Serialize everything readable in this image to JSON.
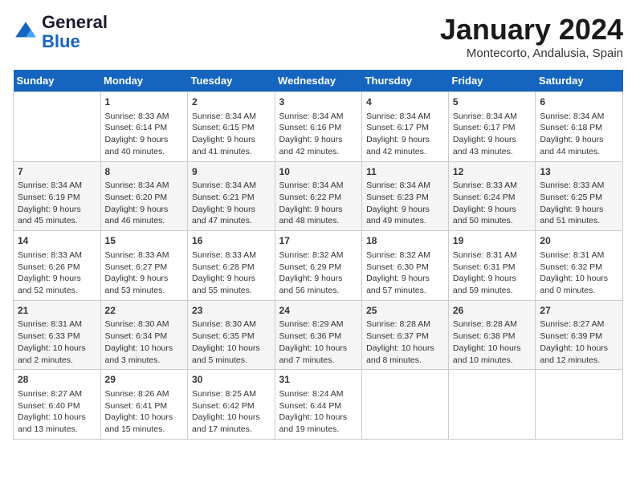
{
  "logo": {
    "line1": "General",
    "line2": "Blue"
  },
  "header": {
    "month": "January 2024",
    "location": "Montecorto, Andalusia, Spain"
  },
  "weekdays": [
    "Sunday",
    "Monday",
    "Tuesday",
    "Wednesday",
    "Thursday",
    "Friday",
    "Saturday"
  ],
  "weeks": [
    [
      {
        "day": "",
        "sunrise": "",
        "sunset": "",
        "daylight": ""
      },
      {
        "day": "1",
        "sunrise": "Sunrise: 8:33 AM",
        "sunset": "Sunset: 6:14 PM",
        "daylight": "Daylight: 9 hours and 40 minutes."
      },
      {
        "day": "2",
        "sunrise": "Sunrise: 8:34 AM",
        "sunset": "Sunset: 6:15 PM",
        "daylight": "Daylight: 9 hours and 41 minutes."
      },
      {
        "day": "3",
        "sunrise": "Sunrise: 8:34 AM",
        "sunset": "Sunset: 6:16 PM",
        "daylight": "Daylight: 9 hours and 42 minutes."
      },
      {
        "day": "4",
        "sunrise": "Sunrise: 8:34 AM",
        "sunset": "Sunset: 6:17 PM",
        "daylight": "Daylight: 9 hours and 42 minutes."
      },
      {
        "day": "5",
        "sunrise": "Sunrise: 8:34 AM",
        "sunset": "Sunset: 6:17 PM",
        "daylight": "Daylight: 9 hours and 43 minutes."
      },
      {
        "day": "6",
        "sunrise": "Sunrise: 8:34 AM",
        "sunset": "Sunset: 6:18 PM",
        "daylight": "Daylight: 9 hours and 44 minutes."
      }
    ],
    [
      {
        "day": "7",
        "sunrise": "Sunrise: 8:34 AM",
        "sunset": "Sunset: 6:19 PM",
        "daylight": "Daylight: 9 hours and 45 minutes."
      },
      {
        "day": "8",
        "sunrise": "Sunrise: 8:34 AM",
        "sunset": "Sunset: 6:20 PM",
        "daylight": "Daylight: 9 hours and 46 minutes."
      },
      {
        "day": "9",
        "sunrise": "Sunrise: 8:34 AM",
        "sunset": "Sunset: 6:21 PM",
        "daylight": "Daylight: 9 hours and 47 minutes."
      },
      {
        "day": "10",
        "sunrise": "Sunrise: 8:34 AM",
        "sunset": "Sunset: 6:22 PM",
        "daylight": "Daylight: 9 hours and 48 minutes."
      },
      {
        "day": "11",
        "sunrise": "Sunrise: 8:34 AM",
        "sunset": "Sunset: 6:23 PM",
        "daylight": "Daylight: 9 hours and 49 minutes."
      },
      {
        "day": "12",
        "sunrise": "Sunrise: 8:33 AM",
        "sunset": "Sunset: 6:24 PM",
        "daylight": "Daylight: 9 hours and 50 minutes."
      },
      {
        "day": "13",
        "sunrise": "Sunrise: 8:33 AM",
        "sunset": "Sunset: 6:25 PM",
        "daylight": "Daylight: 9 hours and 51 minutes."
      }
    ],
    [
      {
        "day": "14",
        "sunrise": "Sunrise: 8:33 AM",
        "sunset": "Sunset: 6:26 PM",
        "daylight": "Daylight: 9 hours and 52 minutes."
      },
      {
        "day": "15",
        "sunrise": "Sunrise: 8:33 AM",
        "sunset": "Sunset: 6:27 PM",
        "daylight": "Daylight: 9 hours and 53 minutes."
      },
      {
        "day": "16",
        "sunrise": "Sunrise: 8:33 AM",
        "sunset": "Sunset: 6:28 PM",
        "daylight": "Daylight: 9 hours and 55 minutes."
      },
      {
        "day": "17",
        "sunrise": "Sunrise: 8:32 AM",
        "sunset": "Sunset: 6:29 PM",
        "daylight": "Daylight: 9 hours and 56 minutes."
      },
      {
        "day": "18",
        "sunrise": "Sunrise: 8:32 AM",
        "sunset": "Sunset: 6:30 PM",
        "daylight": "Daylight: 9 hours and 57 minutes."
      },
      {
        "day": "19",
        "sunrise": "Sunrise: 8:31 AM",
        "sunset": "Sunset: 6:31 PM",
        "daylight": "Daylight: 9 hours and 59 minutes."
      },
      {
        "day": "20",
        "sunrise": "Sunrise: 8:31 AM",
        "sunset": "Sunset: 6:32 PM",
        "daylight": "Daylight: 10 hours and 0 minutes."
      }
    ],
    [
      {
        "day": "21",
        "sunrise": "Sunrise: 8:31 AM",
        "sunset": "Sunset: 6:33 PM",
        "daylight": "Daylight: 10 hours and 2 minutes."
      },
      {
        "day": "22",
        "sunrise": "Sunrise: 8:30 AM",
        "sunset": "Sunset: 6:34 PM",
        "daylight": "Daylight: 10 hours and 3 minutes."
      },
      {
        "day": "23",
        "sunrise": "Sunrise: 8:30 AM",
        "sunset": "Sunset: 6:35 PM",
        "daylight": "Daylight: 10 hours and 5 minutes."
      },
      {
        "day": "24",
        "sunrise": "Sunrise: 8:29 AM",
        "sunset": "Sunset: 6:36 PM",
        "daylight": "Daylight: 10 hours and 7 minutes."
      },
      {
        "day": "25",
        "sunrise": "Sunrise: 8:28 AM",
        "sunset": "Sunset: 6:37 PM",
        "daylight": "Daylight: 10 hours and 8 minutes."
      },
      {
        "day": "26",
        "sunrise": "Sunrise: 8:28 AM",
        "sunset": "Sunset: 6:38 PM",
        "daylight": "Daylight: 10 hours and 10 minutes."
      },
      {
        "day": "27",
        "sunrise": "Sunrise: 8:27 AM",
        "sunset": "Sunset: 6:39 PM",
        "daylight": "Daylight: 10 hours and 12 minutes."
      }
    ],
    [
      {
        "day": "28",
        "sunrise": "Sunrise: 8:27 AM",
        "sunset": "Sunset: 6:40 PM",
        "daylight": "Daylight: 10 hours and 13 minutes."
      },
      {
        "day": "29",
        "sunrise": "Sunrise: 8:26 AM",
        "sunset": "Sunset: 6:41 PM",
        "daylight": "Daylight: 10 hours and 15 minutes."
      },
      {
        "day": "30",
        "sunrise": "Sunrise: 8:25 AM",
        "sunset": "Sunset: 6:42 PM",
        "daylight": "Daylight: 10 hours and 17 minutes."
      },
      {
        "day": "31",
        "sunrise": "Sunrise: 8:24 AM",
        "sunset": "Sunset: 6:44 PM",
        "daylight": "Daylight: 10 hours and 19 minutes."
      },
      {
        "day": "",
        "sunrise": "",
        "sunset": "",
        "daylight": ""
      },
      {
        "day": "",
        "sunrise": "",
        "sunset": "",
        "daylight": ""
      },
      {
        "day": "",
        "sunrise": "",
        "sunset": "",
        "daylight": ""
      }
    ]
  ]
}
